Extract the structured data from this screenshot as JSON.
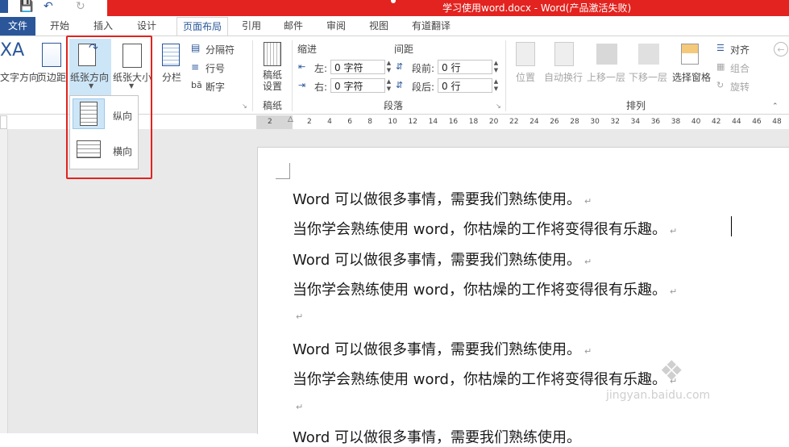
{
  "window": {
    "title": "学习使用word.docx - Word(产品激活失败)"
  },
  "tabs": [
    "文件",
    "开始",
    "插入",
    "设计",
    "页面布局",
    "引用",
    "邮件",
    "审阅",
    "视图",
    "有道翻译"
  ],
  "page_setup": {
    "text_direction": "文字方向",
    "margins": "页边距",
    "orientation": "纸张方向",
    "size": "纸张大小",
    "columns": "分栏",
    "breaks": "分隔符",
    "line_numbers": "行号",
    "hyphenation": "断字"
  },
  "paper_group": {
    "label": "稿纸设置",
    "group": "稿纸"
  },
  "paragraph": {
    "indent_label": "缩进",
    "spacing_label": "间距",
    "left_label": "左:",
    "right_label": "右:",
    "left_value": "0 字符",
    "right_value": "0 字符",
    "before_label": "段前:",
    "after_label": "段后:",
    "before_value": "0 行",
    "after_value": "0 行",
    "group": "段落"
  },
  "arrange": {
    "position": "位置",
    "wrap": "自动换行",
    "forward": "上移一层",
    "backward": "下移一层",
    "selection_pane": "选择窗格",
    "align": "对齐",
    "group_cmd": "组合",
    "rotate": "旋转",
    "group": "排列"
  },
  "orientation_menu": {
    "portrait": "纵向",
    "landscape": "横向"
  },
  "ruler": [
    "2",
    "2",
    "4",
    "6",
    "8",
    "10",
    "12",
    "14",
    "16",
    "18",
    "20",
    "22",
    "24",
    "26",
    "28",
    "30",
    "32",
    "34",
    "36",
    "38",
    "40",
    "42",
    "44",
    "46",
    "48"
  ],
  "document": {
    "lines": [
      "Word 可以做很多事情，需要我们熟练使用。",
      "当你学会熟练使用 word，你枯燥的工作将变得很有乐趣。",
      "Word 可以做很多事情，需要我们熟练使用。",
      "当你学会熟练使用 word，你枯燥的工作将变得很有乐趣。",
      "",
      "Word 可以做很多事情，需要我们熟练使用。",
      "当你学会熟练使用 word，你枯燥的工作将变得很有乐趣。",
      "",
      "Word 可以做很多事情，需要我们熟练使用。"
    ],
    "paragraph_mark": "↵"
  },
  "watermark": "jingyan.baidu.com",
  "colors": {
    "accent": "#2b579a",
    "title_red": "#e2231f",
    "highlight": "#cde6f7"
  }
}
